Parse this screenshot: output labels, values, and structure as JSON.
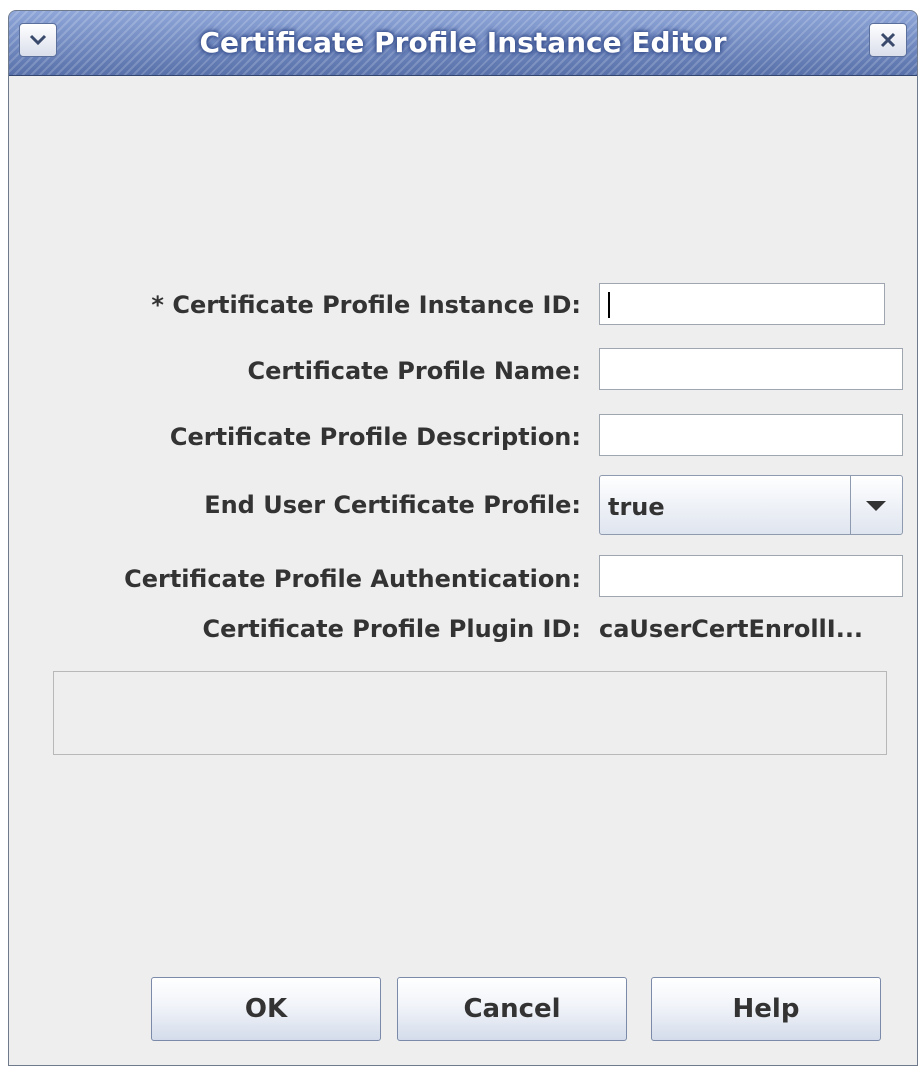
{
  "window": {
    "title": "Certificate Profile Instance Editor",
    "menu_icon": "chevron-down-icon",
    "close_icon": "close-icon",
    "accent_color": "#6f8ac4"
  },
  "form": {
    "fields": [
      {
        "label": "* Certificate Profile Instance ID:",
        "value": ""
      },
      {
        "label": "Certificate Profile Name:",
        "value": ""
      },
      {
        "label": "Certificate Profile Description:",
        "value": ""
      },
      {
        "label": "End User Certificate Profile:",
        "value": "true"
      },
      {
        "label": "Certificate Profile Authentication:",
        "value": ""
      },
      {
        "label": "Certificate Profile Plugin ID:",
        "value": "caUserCertEnrollI..."
      }
    ]
  },
  "buttons": {
    "ok": "OK",
    "cancel": "Cancel",
    "help": "Help"
  }
}
